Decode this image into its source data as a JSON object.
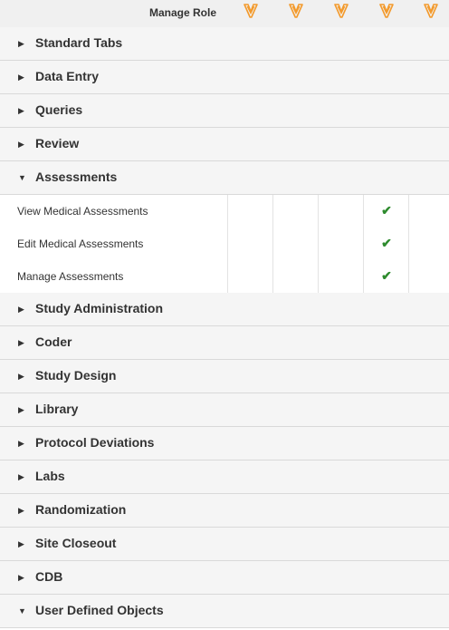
{
  "header": {
    "label": "Manage Role",
    "role_columns": 5,
    "icon": "veeva-v-icon",
    "icon_color": "#f39a2c"
  },
  "sections": [
    {
      "label": "Standard Tabs",
      "expanded": false
    },
    {
      "label": "Data Entry",
      "expanded": false
    },
    {
      "label": "Queries",
      "expanded": false
    },
    {
      "label": "Review",
      "expanded": false
    },
    {
      "label": "Assessments",
      "expanded": true
    },
    {
      "label": "Study Administration",
      "expanded": false
    },
    {
      "label": "Coder",
      "expanded": false
    },
    {
      "label": "Study Design",
      "expanded": false
    },
    {
      "label": "Library",
      "expanded": false
    },
    {
      "label": "Protocol Deviations",
      "expanded": false
    },
    {
      "label": "Labs",
      "expanded": false
    },
    {
      "label": "Randomization",
      "expanded": false
    },
    {
      "label": "Site Closeout",
      "expanded": false
    },
    {
      "label": "CDB",
      "expanded": false
    },
    {
      "label": "User Defined Objects",
      "expanded": true
    }
  ],
  "assessments_rows": [
    {
      "label": "View Medical Assessments",
      "checks": [
        false,
        false,
        false,
        true,
        false
      ]
    },
    {
      "label": "Edit Medical Assessments",
      "checks": [
        false,
        false,
        false,
        true,
        false
      ]
    },
    {
      "label": "Manage Assessments",
      "checks": [
        false,
        false,
        false,
        true,
        false
      ]
    }
  ],
  "check_color": "#2e8b2e"
}
